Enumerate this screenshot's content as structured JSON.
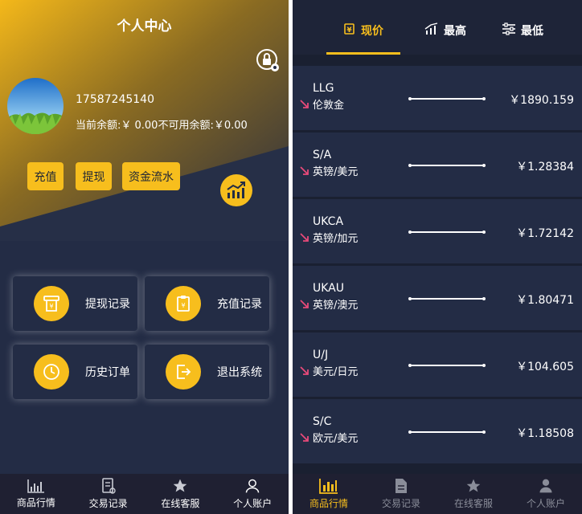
{
  "left": {
    "title": "个人中心",
    "phone": "17587245140",
    "balance_text": "当前余额:￥ 0.00不可用余额:￥0.00",
    "actions": [
      {
        "label": "充值"
      },
      {
        "label": "提现"
      },
      {
        "label": "资金流水"
      }
    ],
    "cards": [
      {
        "label": "提现记录",
        "icon": "withdraw-receipt-icon"
      },
      {
        "label": "充值记录",
        "icon": "clipboard-icon"
      },
      {
        "label": "历史订单",
        "icon": "clock-icon"
      },
      {
        "label": "退出系统",
        "icon": "logout-icon"
      }
    ],
    "tabs": [
      {
        "label": "商品行情",
        "icon": "chart-icon"
      },
      {
        "label": "交易记录",
        "icon": "document-icon"
      },
      {
        "label": "在线客服",
        "icon": "star-icon"
      },
      {
        "label": "个人账户",
        "icon": "user-icon"
      }
    ]
  },
  "right": {
    "sort_tabs": [
      {
        "label": "现价",
        "icon": "price-tag-icon",
        "active": true
      },
      {
        "label": "最高",
        "icon": "bar-chart-icon",
        "active": false
      },
      {
        "label": "最低",
        "icon": "sliders-icon",
        "active": false
      }
    ],
    "quotes": [
      {
        "code": "LLG",
        "name": "伦敦金",
        "price": "￥1890.159"
      },
      {
        "code": "S/A",
        "name": "英镑/美元",
        "price": "￥1.28384"
      },
      {
        "code": "UKCA",
        "name": "英镑/加元",
        "price": "￥1.72142"
      },
      {
        "code": "UKAU",
        "name": "英镑/澳元",
        "price": "￥1.80471"
      },
      {
        "code": "U/J",
        "name": "美元/日元",
        "price": "￥104.605"
      },
      {
        "code": "S/C",
        "name": "欧元/美元",
        "price": "￥1.18508"
      }
    ],
    "tabs": [
      {
        "label": "商品行情",
        "icon": "chart-icon",
        "active": true
      },
      {
        "label": "交易记录",
        "icon": "document-icon",
        "active": false
      },
      {
        "label": "在线客服",
        "icon": "star-icon",
        "active": false
      },
      {
        "label": "个人账户",
        "icon": "user-icon",
        "active": false
      }
    ]
  },
  "colors": {
    "accent": "#f7be1d",
    "panel": "#232c45",
    "background": "#1a2031",
    "down_arrow": "#e84a7a"
  }
}
